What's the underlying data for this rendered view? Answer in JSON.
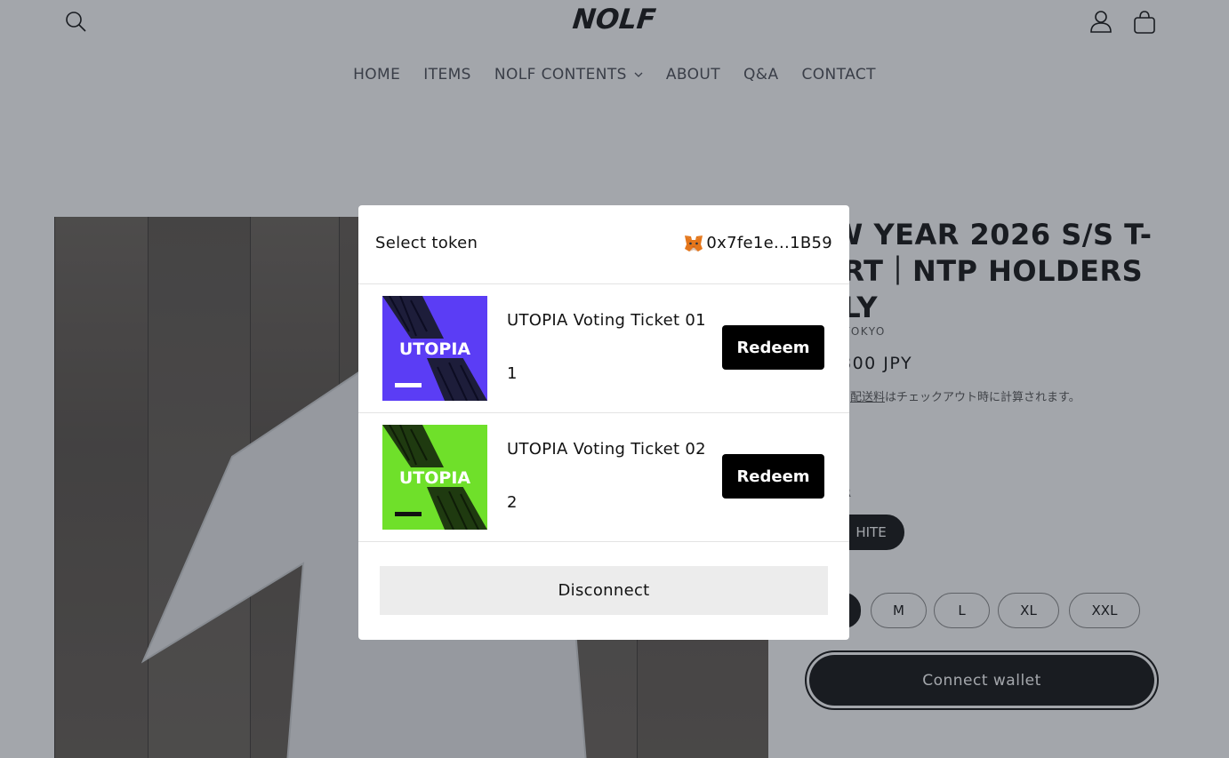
{
  "header": {
    "logo": "NOLF",
    "nav": [
      "HOME",
      "ITEMS",
      "NOLF CONTENTS",
      "ABOUT",
      "Q&A",
      "CONTACT"
    ]
  },
  "product": {
    "title": "NEW YEAR 2026 S/S T-SHIRT｜NTP HOLDERS ONLY",
    "title_visible": "W YEAR 2026 S/S T-\nIRT｜NTP HOLDERS\nILY",
    "vendor": "TOKYO",
    "price": "800 JPY",
    "shipping_link": "配送料",
    "shipping_text": "はチェックアウト時に計算されます。",
    "color_label": "R",
    "color_value": "HITE",
    "sizes": [
      "M",
      "L",
      "XL",
      "XXL"
    ],
    "connect_button": "Connect wallet"
  },
  "modal": {
    "title": "Select token",
    "wallet_address": "0x7fe1e...1B59",
    "tokens": [
      {
        "name": "UTOPIA Voting Ticket 01",
        "quantity": "1",
        "art_text": "UTOPIA",
        "art_color": "#5b3df5",
        "button": "Redeem"
      },
      {
        "name": "UTOPIA Voting Ticket 02",
        "quantity": "2",
        "art_text": "UTOPIA",
        "art_color": "#6fe02a",
        "button": "Redeem"
      }
    ],
    "disconnect_label": "Disconnect"
  },
  "colors": {
    "header_bg": "#ffffff",
    "overlay": "rgba(35,43,56,0.42)",
    "button_dark": "#121212"
  }
}
